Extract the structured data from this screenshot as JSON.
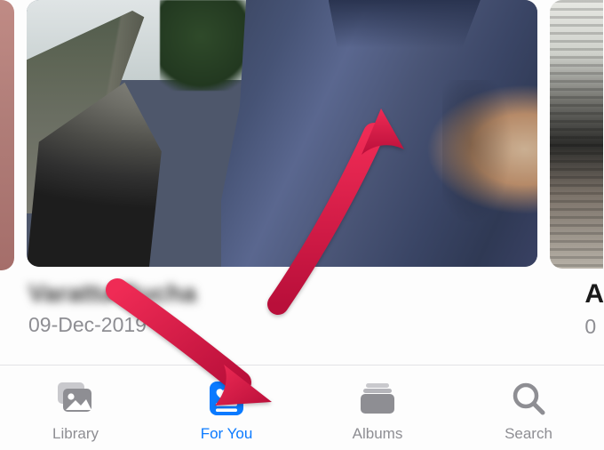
{
  "memory": {
    "title_blurred": "Varattu Pucha",
    "date": "09-Dec-2019"
  },
  "memory_right": {
    "title_initial": "A",
    "date_initial": "0"
  },
  "tabbar": {
    "library": "Library",
    "for_you": "For You",
    "albums": "Albums",
    "search": "Search",
    "active": "for_you"
  },
  "colors": {
    "accent": "#0a7aff",
    "inactive": "#8e8e93",
    "arrow": "#d91243"
  }
}
